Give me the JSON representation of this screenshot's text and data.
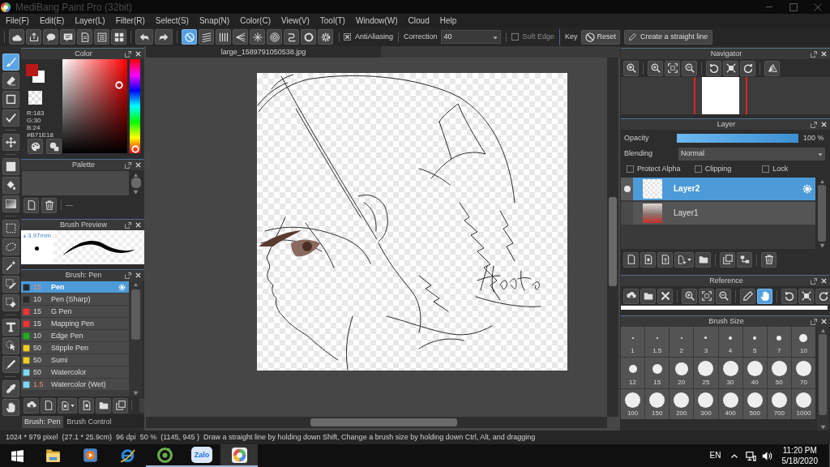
{
  "window": {
    "title": "MediBang Paint Pro (32bit)"
  },
  "menu": [
    "File(F)",
    "Edit(E)",
    "Layer(L)",
    "Filter(R)",
    "Select(S)",
    "Snap(N)",
    "Color(C)",
    "View(V)",
    "Tool(T)",
    "Window(W)",
    "Cloud",
    "Help"
  ],
  "toolbar": {
    "snap_modes": [
      {
        "selected": true
      },
      {
        "selected": false
      },
      {
        "selected": false
      },
      {
        "selected": false
      },
      {
        "selected": false
      },
      {
        "selected": false
      },
      {
        "selected": false
      },
      {
        "selected": false
      }
    ],
    "antialiasing": {
      "label": "AntiAliasing",
      "checked": true
    },
    "correction": {
      "label": "Correction",
      "value": "40"
    },
    "soft_edge": {
      "label": "Soft Edge",
      "checked": false
    },
    "key_label": "Key",
    "reset_button": "Reset",
    "straight_line_button": "Create a straight line"
  },
  "tools": [
    {
      "selected": true
    },
    {
      "selected": false
    },
    {
      "selected": false
    },
    {
      "selected": false
    },
    {
      "selected": false
    },
    {
      "selected": false
    },
    {
      "selected": false
    },
    {
      "selected": false
    },
    {
      "selected": false
    },
    {
      "selected": false
    },
    {
      "selected": false
    },
    {
      "selected": false
    },
    {
      "selected": false
    },
    {
      "selected": false
    },
    {
      "selected": false
    },
    {
      "selected": false
    },
    {
      "selected": false
    },
    {
      "selected": false
    }
  ],
  "color_panel": {
    "title": "Color",
    "readout": [
      "R:183",
      "G:30",
      "B:24",
      "#B71E18"
    ],
    "saturation": {
      "level": 0.87
    },
    "value": {
      "level": 0.72
    },
    "hue": {
      "level": 0
    }
  },
  "palette_panel": {
    "title": "Palette",
    "divider_text": "---"
  },
  "brush_preview": {
    "title": "Brush Preview",
    "size": "3.97mm"
  },
  "brush_panel": {
    "title": "Brush: Pen",
    "brushes": [
      {
        "size": "15",
        "size_highlighted": true,
        "name": "Pen",
        "color": "#2a2a2a",
        "selected": true
      },
      {
        "size": "10",
        "size_highlighted": false,
        "name": "Pen (Sharp)",
        "color": "#2a2a2a",
        "selected": false
      },
      {
        "size": "15",
        "size_highlighted": false,
        "name": "G Pen",
        "color": "#ee3333",
        "selected": false
      },
      {
        "size": "15",
        "size_highlighted": false,
        "name": "Mapping Pen",
        "color": "#ee3333",
        "selected": false
      },
      {
        "size": "10",
        "size_highlighted": false,
        "name": "Edge Pen",
        "color": "#22aa22",
        "selected": false
      },
      {
        "size": "50",
        "size_highlighted": false,
        "name": "Stipple Pen",
        "color": "#eecc22",
        "selected": false
      },
      {
        "size": "50",
        "size_highlighted": false,
        "name": "Sumi",
        "color": "#eecc22",
        "selected": false
      },
      {
        "size": "50",
        "size_highlighted": false,
        "name": "Watercolor",
        "color": "#7dd6f5",
        "selected": false
      },
      {
        "size": "1.5",
        "size_highlighted": true,
        "name": "Watercolor (Wet)",
        "color": "#7dd6f5",
        "selected": false
      }
    ],
    "tabs": [
      {
        "label": "Brush: Pen",
        "selected": true
      },
      {
        "label": "Brush Control",
        "selected": false
      }
    ]
  },
  "document": {
    "tab": "large_1589791050538.jpg"
  },
  "navigator": {
    "title": "Navigator"
  },
  "layer_panel": {
    "title": "Layer",
    "opacity": {
      "label": "Opacity",
      "level": 1,
      "reading": "100 %"
    },
    "blending": {
      "label": "Blending",
      "value": "Normal"
    },
    "options": [
      {
        "label": "Protect Alpha",
        "checked": false
      },
      {
        "label": "Clipping",
        "checked": false
      },
      {
        "label": "Lock",
        "checked": false
      }
    ],
    "layers": [
      {
        "name": "Layer2",
        "selected": true
      },
      {
        "name": "Layer1",
        "selected": false
      }
    ]
  },
  "reference_panel": {
    "title": "Reference",
    "modes": [
      {
        "selected": false
      },
      {
        "selected": true
      }
    ]
  },
  "brush_size_panel": {
    "title": "Brush Size",
    "sizes": [
      "1",
      "1.5",
      "2",
      "3",
      "4",
      "5",
      "7",
      "10",
      "12",
      "15",
      "20",
      "25",
      "30",
      "40",
      "50",
      "70",
      "100",
      "150",
      "200",
      "300",
      "400",
      "500",
      "700",
      "1000"
    ]
  },
  "status_bar": [
    "1024 * 979 pixel",
    "(27.1 * 25.9cm)",
    "96 dpi",
    "50 %",
    "(1145, 945 )",
    "Draw a straight line by holding down Shift, Change a brush size by holding down Ctrl, Alt, and dragging"
  ],
  "taskbar": {
    "apps": [
      {
        "running": false,
        "selected": false
      },
      {
        "running": false,
        "selected": false
      },
      {
        "running": false,
        "selected": false
      },
      {
        "running": true,
        "selected": false
      },
      {
        "running": true,
        "selected": false
      },
      {
        "running": true,
        "selected": true
      }
    ],
    "chat_app_label": "Zalo",
    "language": "EN",
    "time": "11:20 PM",
    "date": "5/18/2020"
  }
}
